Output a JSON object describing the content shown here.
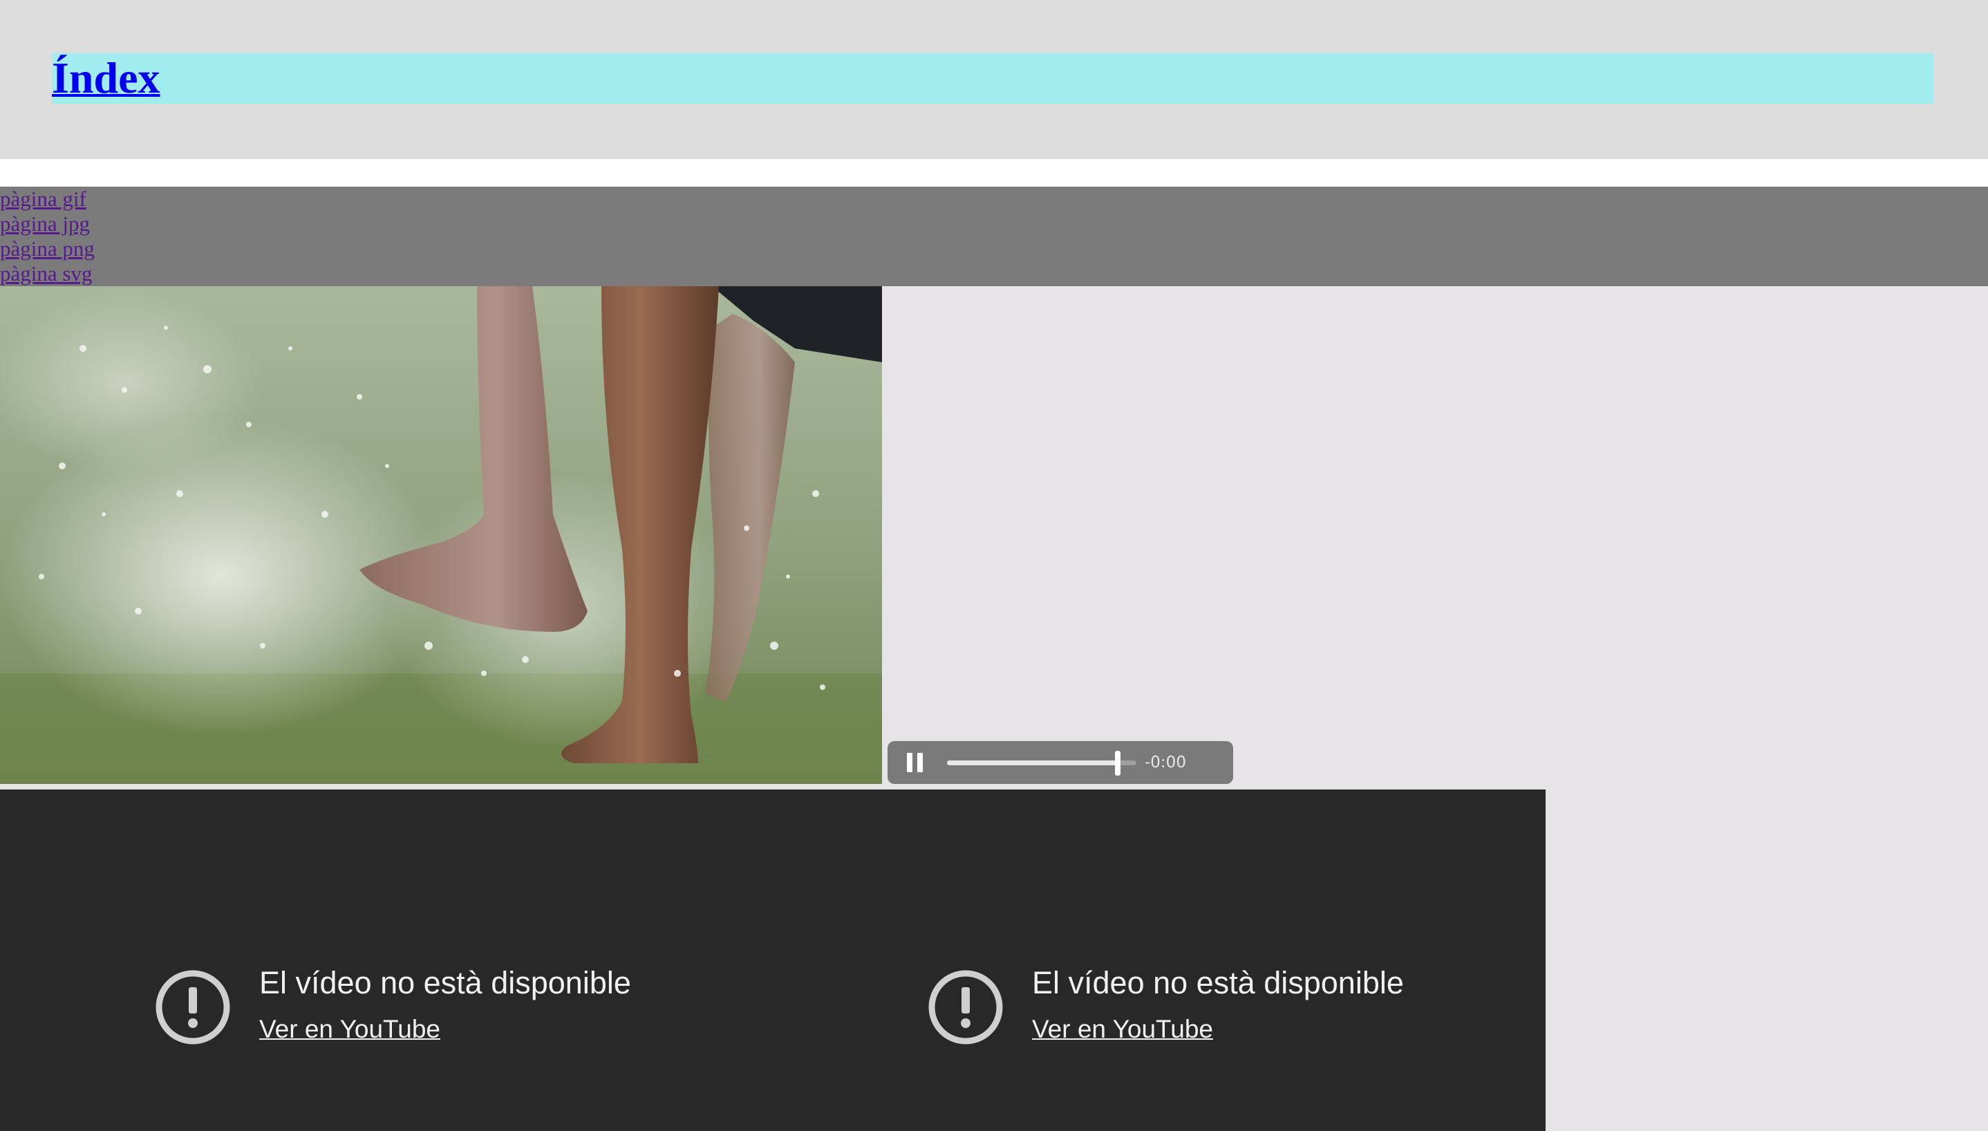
{
  "header": {
    "title": "Índex",
    "bar_color": "#a1ecee",
    "background_color": "#dcdcdc"
  },
  "nav": {
    "background_color": "#7b7b7b",
    "links": [
      {
        "label": "pàgina gif"
      },
      {
        "label": "pàgina jpg"
      },
      {
        "label": "pàgina png"
      },
      {
        "label": "pàgina svg"
      }
    ]
  },
  "video": {
    "state": "playing",
    "play_control_icon": "pause-icon",
    "progress": 0.9,
    "time_remaining": "-0:00"
  },
  "embeds": {
    "background_color": "#282828",
    "items": [
      {
        "icon": "alert-icon",
        "message": "El vídeo no està disponible",
        "link": "Ver en YouTube"
      },
      {
        "icon": "alert-icon",
        "message": "El vídeo no està disponible",
        "link": "Ver en YouTube"
      }
    ]
  }
}
